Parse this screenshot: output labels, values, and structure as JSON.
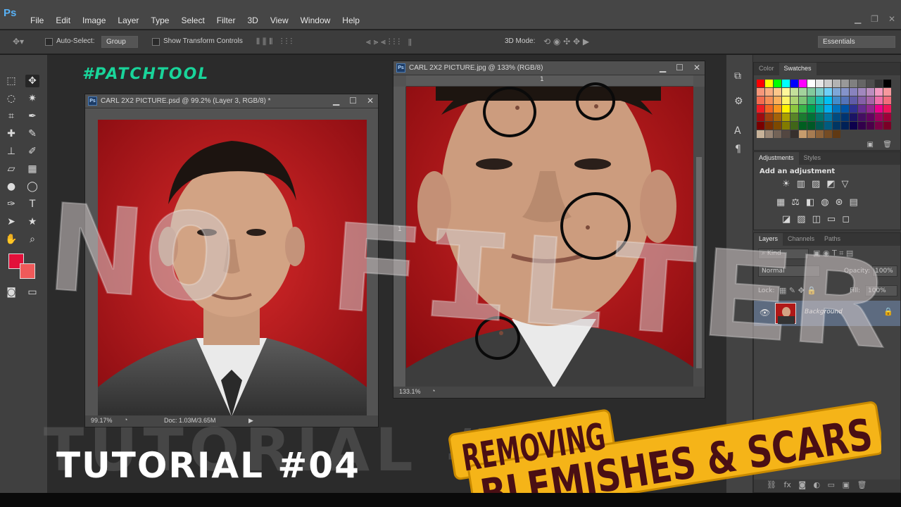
{
  "app": {
    "logo": "Ps",
    "menus": [
      "File",
      "Edit",
      "Image",
      "Layer",
      "Type",
      "Select",
      "Filter",
      "3D",
      "View",
      "Window",
      "Help"
    ]
  },
  "options": {
    "auto_select_label": "Auto-Select:",
    "auto_select_value": "Group",
    "transform_label": "Show Transform Controls",
    "mode_label": "3D Mode:",
    "workspace": "Essentials"
  },
  "doc1": {
    "title": "CARL 2X2 PICTURE.psd @ 99.2% (Layer 3, RGB/8) *",
    "zoom": "99.17%",
    "doc_size": "Doc: 1.03M/3.65M"
  },
  "doc2": {
    "title": "CARL 2X2 PICTURE.jpg @ 133% (RGB/8)",
    "zoom": "133.1%",
    "ruler_top": "1",
    "ruler_left": "1"
  },
  "panels": {
    "color_tab": "Color",
    "swatches_tab": "Swatches",
    "adjustments_tab": "Adjustments",
    "styles_tab": "Styles",
    "add_adjustment": "Add an adjustment",
    "layers_tab": "Layers",
    "channels_tab": "Channels",
    "paths_tab": "Paths",
    "kind": "Kind",
    "blend_mode": "Normal",
    "opacity_label": "Opacity:",
    "opacity_value": "100%",
    "lock_label": "Lock:",
    "fill_label": "Fill:",
    "fill_value": "100%",
    "layer_name": "Background"
  },
  "overlay": {
    "hashtag": "#PATCHTOOL",
    "watermark": "NO FILTER",
    "tutorial_shadow": "TUTORIAL #04",
    "tutorial": "TUTORIAL #04",
    "banner_line1": "REMOVING",
    "banner_line2": "BLEMISHES & SCARS"
  },
  "colors": {
    "banner_fill": "#f5b418",
    "banner_text": "#4a0f14",
    "hashtag": "#19d49a",
    "foreground": "#e3103a",
    "background": "#f05a5a"
  }
}
